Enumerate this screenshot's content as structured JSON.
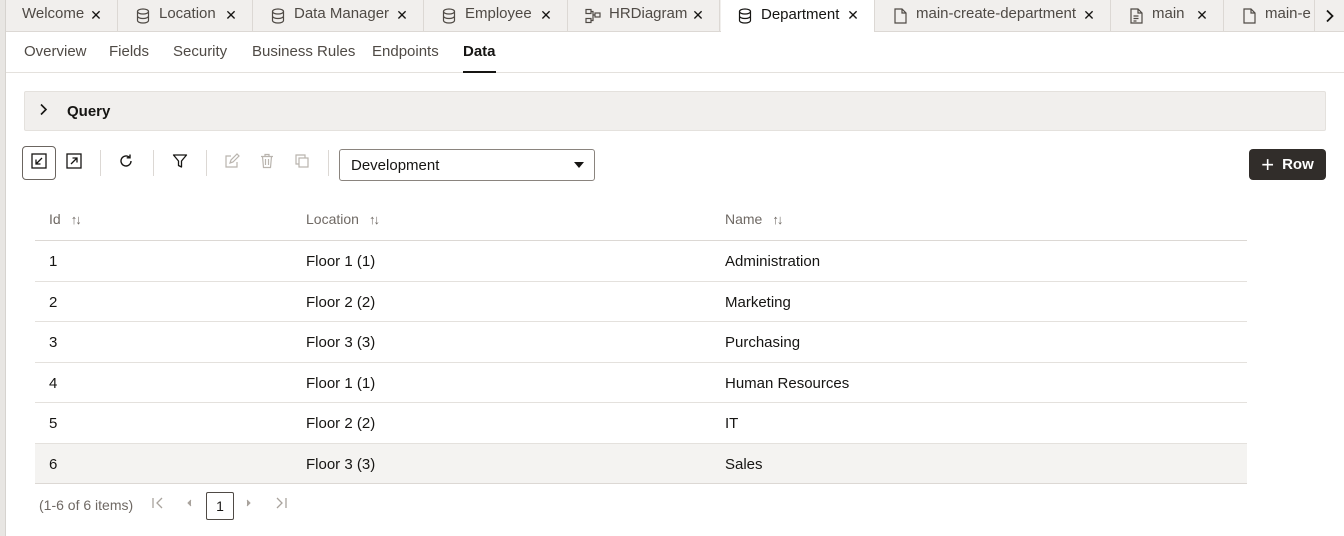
{
  "tabs": [
    {
      "label": "Welcome",
      "icon": "none",
      "active": false
    },
    {
      "label": "Location",
      "icon": "database-icon",
      "active": false
    },
    {
      "label": "Data Manager",
      "icon": "database-icon",
      "active": false
    },
    {
      "label": "Employee",
      "icon": "database-icon",
      "active": false
    },
    {
      "label": "HRDiagram",
      "icon": "diagram-icon",
      "active": false
    },
    {
      "label": "Department",
      "icon": "database-icon",
      "active": true
    },
    {
      "label": "main-create-department",
      "icon": "file-icon",
      "active": false
    },
    {
      "label": "main",
      "icon": "file-code-icon",
      "active": false
    },
    {
      "label": "main-e",
      "icon": "file-icon",
      "active": false
    }
  ],
  "subnav": [
    "Overview",
    "Fields",
    "Security",
    "Business Rules",
    "Endpoints",
    "Data"
  ],
  "subnav_active": "Data",
  "query": {
    "label": "Query"
  },
  "toolbar": {
    "environment": "Development",
    "add_row_label": "Row"
  },
  "table": {
    "columns": [
      "Id",
      "Location",
      "Name"
    ],
    "rows": [
      [
        "1",
        "Floor 1 (1)",
        "Administration"
      ],
      [
        "2",
        "Floor 2 (2)",
        "Marketing"
      ],
      [
        "3",
        "Floor 3 (3)",
        "Purchasing"
      ],
      [
        "4",
        "Floor 1 (1)",
        "Human Resources"
      ],
      [
        "5",
        "Floor 2 (2)",
        "IT"
      ],
      [
        "6",
        "Floor 3 (3)",
        "Sales"
      ]
    ]
  },
  "pagination": {
    "info": "(1-6 of 6 items)",
    "current_page": "1"
  },
  "colors": {
    "accent_dark": "#312d2a",
    "tab_bg": "#f1efed"
  }
}
